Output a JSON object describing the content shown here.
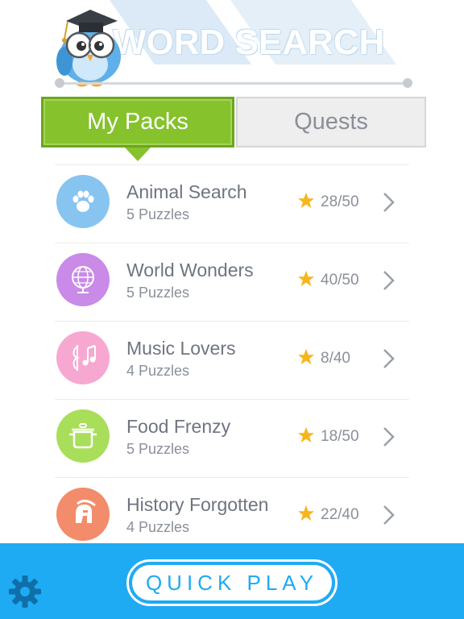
{
  "header": {
    "title": "WORD SEARCH",
    "progress": 1.0
  },
  "tabs": [
    {
      "label": "My Packs",
      "active": true
    },
    {
      "label": "Quests",
      "active": false
    }
  ],
  "packs": [
    {
      "title": "Animal Search",
      "subtitle": "5 Puzzles",
      "score": "28/50",
      "icon": "paw-icon",
      "color": "#88c4f0"
    },
    {
      "title": "World Wonders",
      "subtitle": "5 Puzzles",
      "score": "40/50",
      "icon": "globe-icon",
      "color": "#c98ae8"
    },
    {
      "title": "Music Lovers",
      "subtitle": "4 Puzzles",
      "score": "8/40",
      "icon": "music-notes-icon",
      "color": "#f7a8d0"
    },
    {
      "title": "Food Frenzy",
      "subtitle": "5 Puzzles",
      "score": "18/50",
      "icon": "cooking-pot-icon",
      "color": "#a9de5a"
    },
    {
      "title": "History Forgotten",
      "subtitle": "4 Puzzles",
      "score": "22/40",
      "icon": "spartan-helmet-icon",
      "color": "#f28c6a"
    }
  ],
  "footer": {
    "quick_play_label": "QUICK PLAY",
    "settings_icon": "gear-icon"
  },
  "colors": {
    "accent_green": "#85c22c",
    "footer_blue": "#1faaf4",
    "star": "#f7b51d"
  }
}
